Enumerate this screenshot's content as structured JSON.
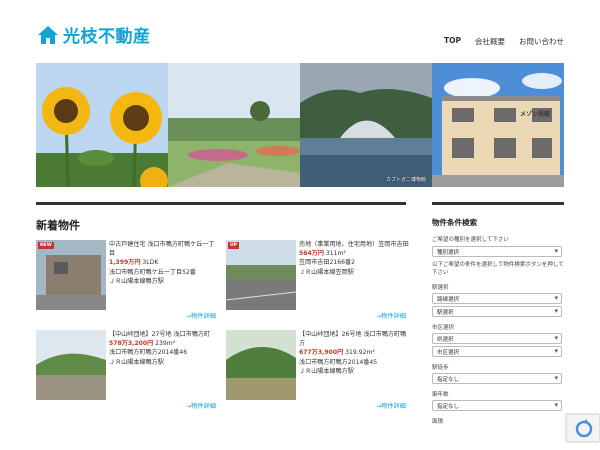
{
  "brand": {
    "name": "光枝不動産",
    "color": "#0fa3d6"
  },
  "nav": [
    "TOP",
    "会社概要",
    "お問い合わせ"
  ],
  "hero": {
    "captions": [
      "",
      "",
      "カブトガニ博物館",
      ""
    ],
    "house_sign": "メゾン光枝"
  },
  "main": {
    "title": "新着物件",
    "listings": [
      {
        "badge": "NEW",
        "title": "中古戸建住宅 浅口市鴨方町鴨ケ丘一丁目",
        "price": "1,399万円",
        "spec": "3LDK",
        "address": "浅口市鴨方町鴨ケ丘一丁目52番",
        "station": "ＪＲ山陽本線鴨方駅",
        "more": "→物件詳細"
      },
      {
        "badge": "UP",
        "title": "売地（事業用地、住宅用地）笠岡市吉田",
        "price": "564万円",
        "spec": "311m²",
        "address": "笠岡市吉田2166番2",
        "station": "ＪＲ山陽本線笠岡駅",
        "more": "→物件詳細"
      },
      {
        "badge": "",
        "title": "【中山峠団地】27号地 浅口市鴨方町",
        "price": "578万3,200円",
        "spec": "239m²",
        "address": "浅口市鴨方町鴨方2014番46",
        "station": "ＪＲ山陽本線鴨方駅",
        "more": "→物件詳細"
      },
      {
        "badge": "",
        "title": "【中山峠団地】26号地 浅口市鴨方町鴨方",
        "price": "677万3,900円",
        "spec": "319.92m²",
        "address": "浅口市鴨方町鴨方2014番45",
        "station": "ＪＲ山陽本線鴨方駅",
        "more": "→物件詳細"
      }
    ]
  },
  "sidebar": {
    "title": "物件条件検索",
    "intro1": "ご希望の種別を選択して下さい",
    "type_select": "種別選択",
    "intro2": "以下ご希望の条件を選択して物件検索ボタンを押して下さい",
    "station_label": "駅選択",
    "line_select": "路線選択",
    "station_select": "駅選択",
    "city_label": "市区選択",
    "pref_select": "県選択",
    "city_select": "市区選択",
    "walk_label": "駅徒歩",
    "walk_select": "指定なし",
    "age_label": "築年数",
    "age_select": "指定なし",
    "area_label": "面積"
  }
}
